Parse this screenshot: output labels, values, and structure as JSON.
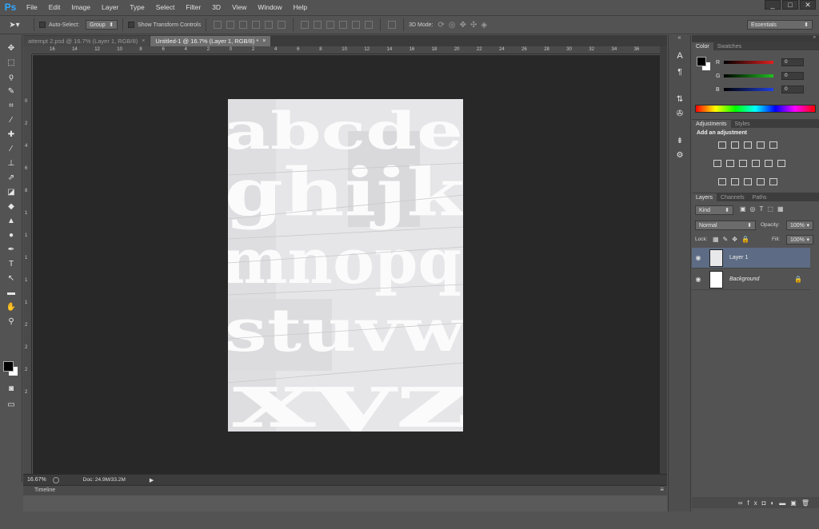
{
  "app": {
    "logo": "Ps"
  },
  "menu": [
    "File",
    "Edit",
    "Image",
    "Layer",
    "Type",
    "Select",
    "Filter",
    "3D",
    "View",
    "Window",
    "Help"
  ],
  "window_controls": [
    "_",
    "□",
    "✕"
  ],
  "options": {
    "auto_select_label": "Auto-Select:",
    "auto_select_value": "Group",
    "transform_label": "Show Transform Controls",
    "mode_3d_label": "3D Mode:",
    "workspace": "Essentials"
  },
  "tabs": [
    {
      "label": "attempt 2.psd @ 16.7% (Layer 1, RGB/8)",
      "close": "×"
    },
    {
      "label": "Untitled-1 @ 16.7% (Layer 1, RGB/8) *",
      "close": "×"
    }
  ],
  "rulers": {
    "top": [
      "16",
      "14",
      "12",
      "10",
      "8",
      "6",
      "4",
      "2",
      "0",
      "2",
      "4",
      "6",
      "8",
      "10",
      "12",
      "14",
      "16",
      "18",
      "20",
      "22",
      "24",
      "26",
      "28",
      "30",
      "32",
      "34",
      "36"
    ],
    "left": [
      "0",
      "2",
      "4",
      "6",
      "8",
      "1",
      "1",
      "1",
      "1",
      "1",
      "2",
      "2",
      "2",
      "2"
    ]
  },
  "status": {
    "zoom": "16.67%",
    "doc": "Doc: 24.9M/33.2M"
  },
  "timeline": "Timeline",
  "color_panel": {
    "tabs": [
      "Color",
      "Swatches"
    ],
    "channels": [
      {
        "label": "R",
        "value": "0",
        "color": "#e02020"
      },
      {
        "label": "G",
        "value": "0",
        "color": "#20c020"
      },
      {
        "label": "B",
        "value": "0",
        "color": "#2040e0"
      }
    ]
  },
  "adjustments_panel": {
    "tabs": [
      "Adjustments",
      "Styles"
    ],
    "heading": "Add an adjustment"
  },
  "layers_panel": {
    "tabs": [
      "Layers",
      "Channels",
      "Paths"
    ],
    "filter": "Kind",
    "blend_mode": "Normal",
    "opacity_label": "Opacity:",
    "opacity": "100%",
    "lock_label": "Lock:",
    "fill_label": "Fill:",
    "fill": "100%",
    "layers": [
      {
        "name": "Layer 1",
        "selected": true
      },
      {
        "name": "Background",
        "selected": false
      }
    ]
  },
  "document_art": {
    "rows": [
      "abcde",
      "ghijk",
      "mnopq",
      "stuvw",
      "xyz"
    ]
  }
}
